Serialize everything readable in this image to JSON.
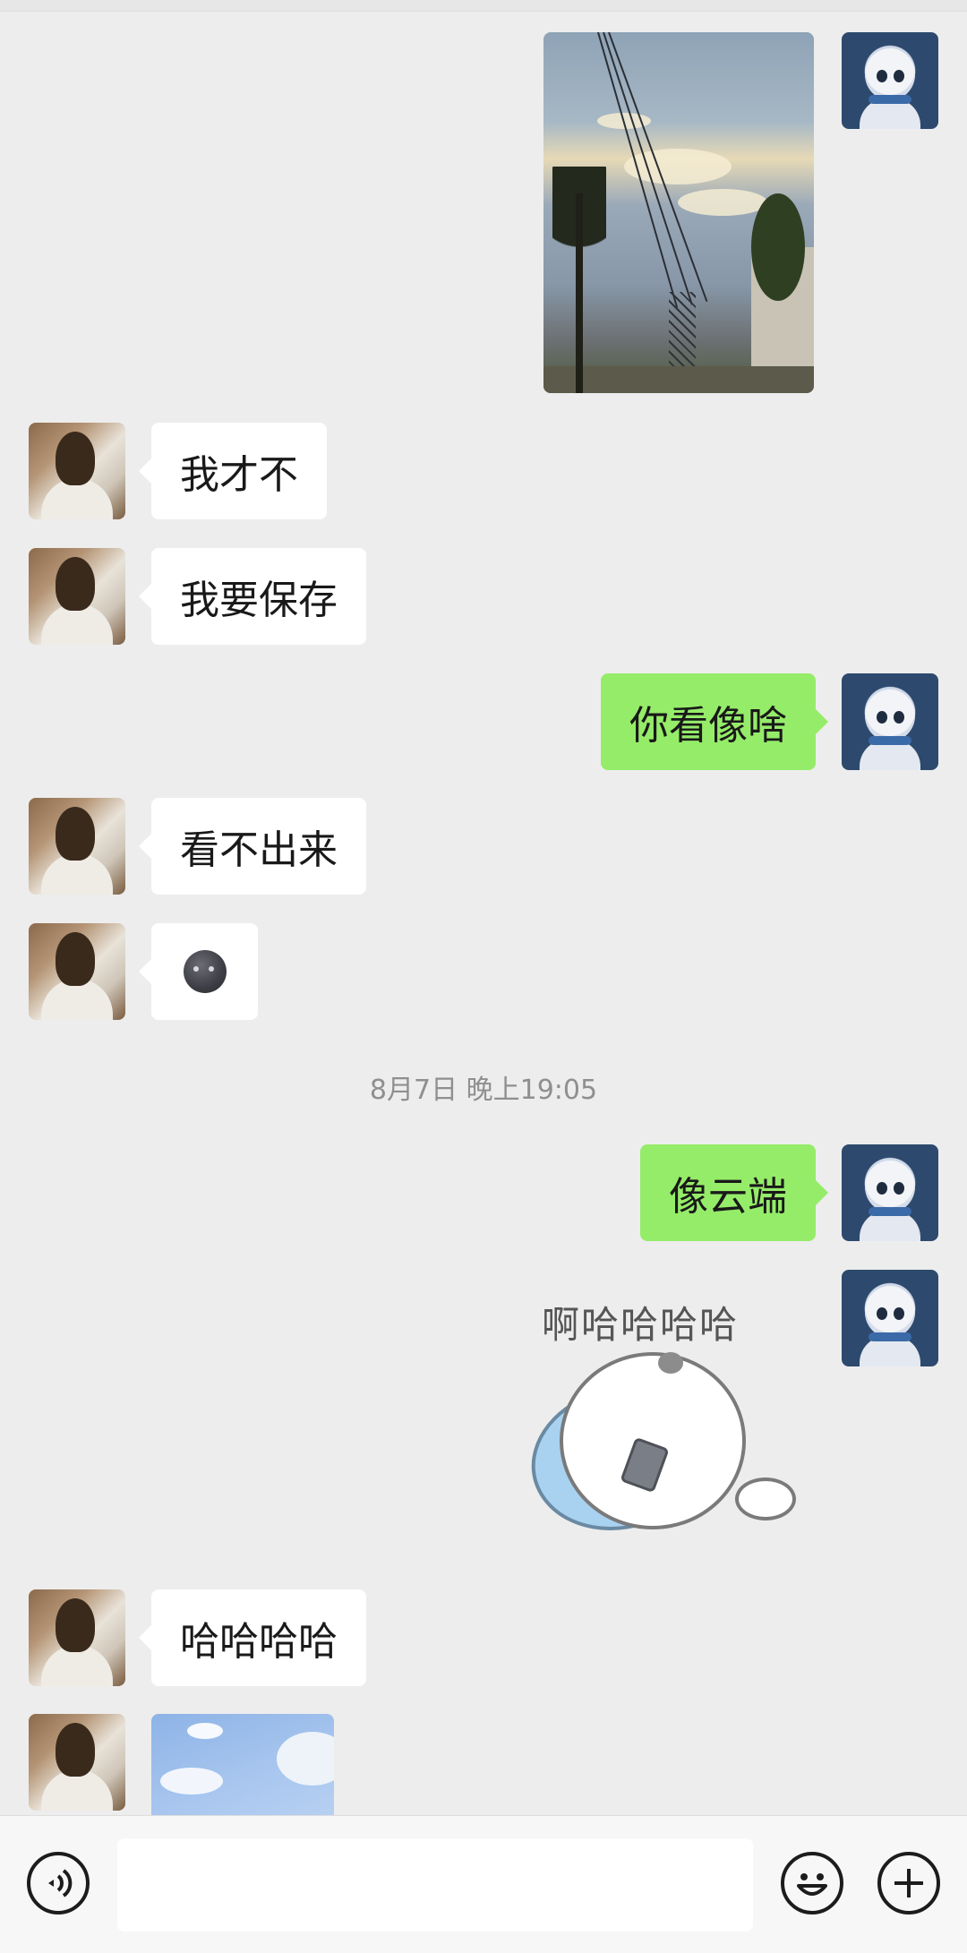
{
  "conversation": {
    "messages": [
      {
        "side": "right",
        "type": "image",
        "desc_icon": "photo-sky-icon"
      },
      {
        "side": "left",
        "type": "text",
        "text": "我才不"
      },
      {
        "side": "left",
        "type": "text",
        "text": "我要保存"
      },
      {
        "side": "right",
        "type": "text",
        "text": "你看像啥"
      },
      {
        "side": "left",
        "type": "text",
        "text": "看不出来"
      },
      {
        "side": "left",
        "type": "emoji",
        "emoji": "new-moon-face-icon"
      },
      {
        "side": "right",
        "type": "text",
        "text": "像云端"
      },
      {
        "side": "right",
        "type": "sticker",
        "sticker_text": "啊哈哈哈哈"
      },
      {
        "side": "left",
        "type": "text",
        "text": "哈哈哈哈"
      },
      {
        "side": "left",
        "type": "image",
        "desc_icon": "photo-blue-sky-icon"
      }
    ],
    "timestamp": "8月7日 晚上19:05"
  },
  "input_bar": {
    "text_value": "",
    "icons": [
      "voice-icon",
      "emoji-icon",
      "plus-icon"
    ]
  },
  "colors": {
    "background": "#ededed",
    "my_bubble": "#95ec69",
    "their_bubble": "#ffffff"
  }
}
